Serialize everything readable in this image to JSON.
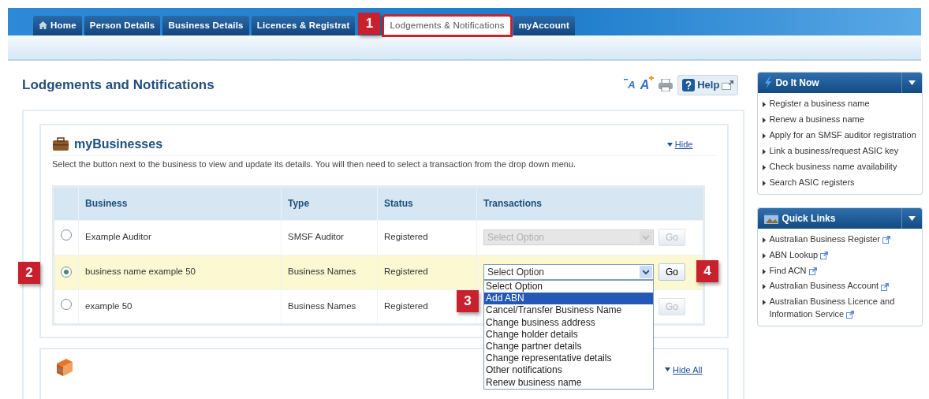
{
  "nav_tabs": [
    {
      "label": "Home",
      "kind": "home",
      "selected": false
    },
    {
      "label": "Person Details",
      "kind": "plain",
      "selected": false
    },
    {
      "label": "Business Details",
      "kind": "plain",
      "selected": false
    },
    {
      "label": "Licences & Registrat",
      "kind": "plain",
      "selected": false
    },
    {
      "label": "Lodgements & Notifications",
      "kind": "plain",
      "selected": true,
      "callout": "1"
    },
    {
      "label": "myAccount",
      "kind": "plain",
      "selected": false
    }
  ],
  "page_title": "Lodgements and Notifications",
  "toolbar": {
    "decrease_text": "A",
    "increase_text": "A",
    "help": "Help"
  },
  "businesses": {
    "title": "myBusinesses",
    "hide_link": "Hide",
    "description": "Select the button next to the business to view and update its details. You will then need to select a transaction from the drop down menu.",
    "columns": [
      "Business",
      "Type",
      "Status",
      "Transactions"
    ],
    "rows": [
      {
        "selected": false,
        "business": "Example Auditor",
        "type": "SMSF Auditor",
        "status": "Registered",
        "select_value": "Select Option",
        "go": "Go",
        "disabled": true
      },
      {
        "selected": true,
        "business": "business name example 50",
        "type": "Business Names",
        "status": "Registered",
        "select_value": "Select Option",
        "go": "Go",
        "disabled": false,
        "callout": "2",
        "go_callout": "4",
        "expanded": true,
        "options": [
          {
            "label": "Select Option",
            "selected": false
          },
          {
            "label": "Add ABN",
            "selected": true,
            "callout": "3"
          },
          {
            "label": "Cancel/Transfer Business Name",
            "selected": false
          },
          {
            "label": "Change business address",
            "selected": false
          },
          {
            "label": "Change holder details",
            "selected": false
          },
          {
            "label": "Change partner details",
            "selected": false
          },
          {
            "label": "Change representative details",
            "selected": false
          },
          {
            "label": "Other notifications",
            "selected": false
          },
          {
            "label": "Renew business name",
            "selected": false
          }
        ]
      },
      {
        "selected": false,
        "business": "example 50",
        "type": "Business Names",
        "status": "Registered",
        "go": "Go",
        "disabled": true
      }
    ]
  },
  "second_panel": {
    "hide_all_link": "Hide All"
  },
  "sidebar": [
    {
      "title": "Do It Now",
      "kind": "bolt",
      "items": [
        {
          "label": "Register a business name",
          "external": false
        },
        {
          "label": "Renew a business name",
          "external": false
        },
        {
          "label": "Apply for an SMSF auditor registration",
          "external": false
        },
        {
          "label": "Link a business/request ASIC key",
          "external": false
        },
        {
          "label": "Check business name availability",
          "external": false
        },
        {
          "label": "Search ASIC registers",
          "external": false
        }
      ]
    },
    {
      "title": "Quick Links",
      "kind": "links",
      "items": [
        {
          "label": "Australian Business Register",
          "external": true
        },
        {
          "label": "ABN Lookup",
          "external": true
        },
        {
          "label": "Find ACN",
          "external": true
        },
        {
          "label": "Australian Business Account",
          "external": true
        },
        {
          "label": "Australian Business Licence and Information Service",
          "external": true
        }
      ]
    }
  ]
}
